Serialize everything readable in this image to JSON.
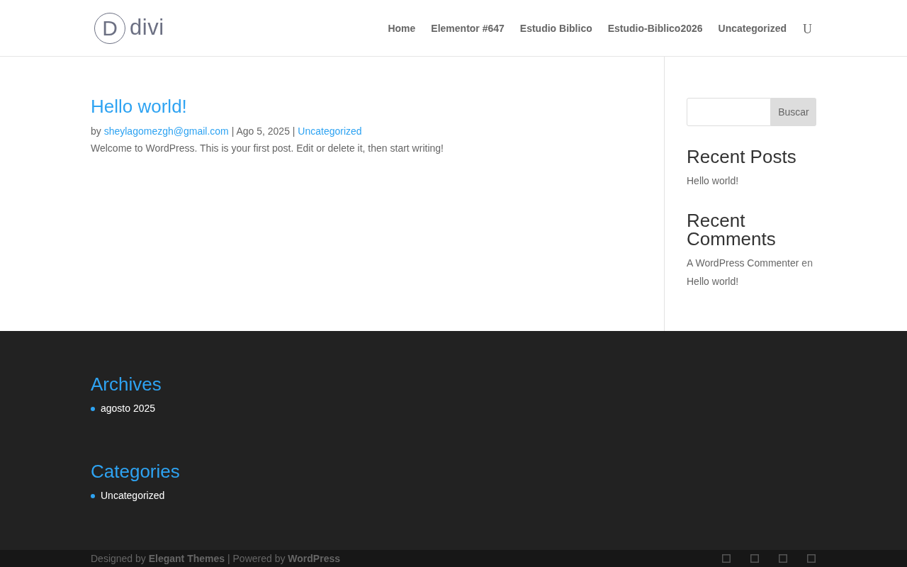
{
  "header": {
    "logo": {
      "mark": "D",
      "text": "divi"
    },
    "nav": [
      {
        "label": "Home"
      },
      {
        "label": "Elementor #647"
      },
      {
        "label": "Estudio Biblico"
      },
      {
        "label": "Estudio-Biblico2026"
      },
      {
        "label": "Uncategorized"
      }
    ],
    "search_glyph": "U"
  },
  "post": {
    "title": "Hello world!",
    "meta": [
      {
        "kind": "text",
        "text": "by"
      },
      {
        "kind": "link",
        "text": "sheylagomezgh@gmail.com"
      },
      {
        "kind": "text",
        "text": "| Ago 5, 2025 |"
      },
      {
        "kind": "link",
        "text": "Uncategorized"
      }
    ],
    "excerpt": "Welcome to WordPress. This is your first post. Edit or delete it, then start writing!"
  },
  "sidebar": {
    "search": {
      "button": "Buscar"
    },
    "widgets": [
      {
        "title": "Recent Posts",
        "items": [
          [
            {
              "kind": "link",
              "text": "Hello world!"
            }
          ]
        ]
      },
      {
        "title": "Recent Comments",
        "items": [
          [
            {
              "kind": "link",
              "text": "A WordPress Commenter"
            },
            {
              "kind": "text",
              "text": "en"
            },
            {
              "kind": "link",
              "text": "Hello world!"
            }
          ]
        ]
      }
    ]
  },
  "footer": {
    "widgets": [
      {
        "title": "Archives",
        "items": [
          "agosto 2025"
        ]
      },
      {
        "title": "Categories",
        "items": [
          "Uncategorized"
        ]
      }
    ]
  },
  "bottom_bar": {
    "credits": [
      {
        "kind": "text",
        "text": "Designed by"
      },
      {
        "kind": "link",
        "text": "Elegant Themes"
      },
      {
        "kind": "text",
        "text": "| Powered by"
      },
      {
        "kind": "link",
        "text": "WordPress"
      }
    ]
  }
}
